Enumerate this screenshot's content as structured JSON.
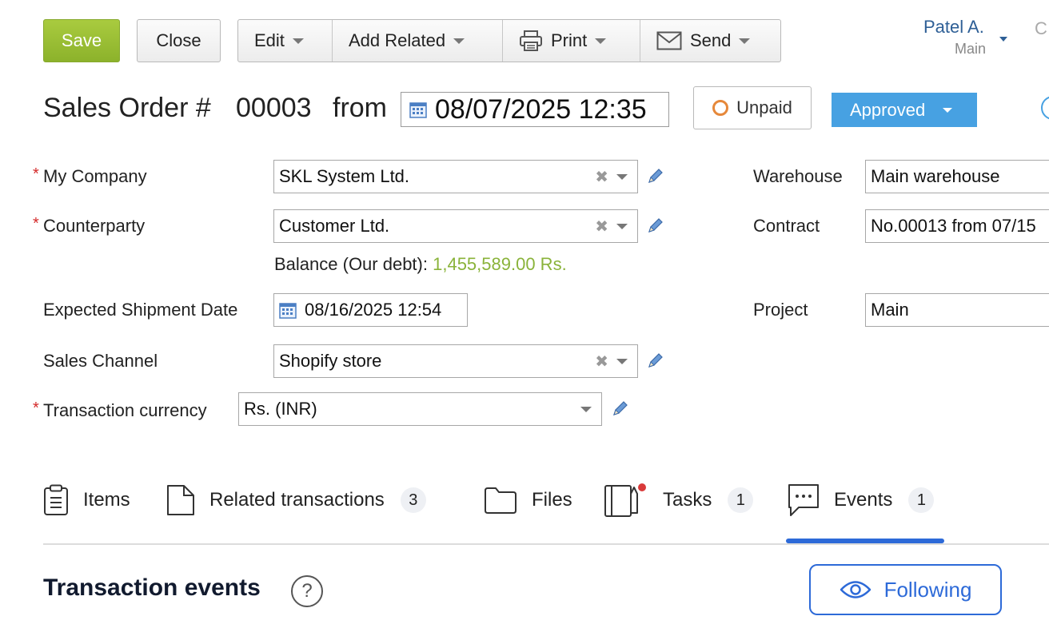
{
  "toolbar": {
    "save": "Save",
    "close": "Close",
    "edit": "Edit",
    "add_related": "Add Related",
    "print": "Print",
    "send": "Send"
  },
  "user": {
    "name": "Patel A.",
    "sub": "Main",
    "next": "C"
  },
  "header": {
    "title": "Sales Order #",
    "number": "00003",
    "from": "from",
    "date": "08/07/2025 12:35",
    "payment_status": "Unpaid",
    "approval_status": "Approved"
  },
  "form": {
    "my_company": {
      "label": "My Company",
      "value": "SKL System Ltd."
    },
    "counterparty": {
      "label": "Counterparty",
      "value": "Customer Ltd."
    },
    "balance": {
      "label": "Balance (Our debt):",
      "value": "1,455,589.00 Rs."
    },
    "shipment_date": {
      "label": "Expected Shipment Date",
      "value": "08/16/2025 12:54"
    },
    "sales_channel": {
      "label": "Sales Channel",
      "value": "Shopify store"
    },
    "currency": {
      "label": "Transaction currency",
      "value": "Rs. (INR)"
    },
    "warehouse": {
      "label": "Warehouse",
      "value": "Main warehouse"
    },
    "contract": {
      "label": "Contract",
      "value": "No.00013 from 07/15"
    },
    "project": {
      "label": "Project",
      "value": "Main"
    },
    "required_mark": "*"
  },
  "tabs": [
    {
      "label": "Items",
      "count": ""
    },
    {
      "label": "Related transactions",
      "count": "3"
    },
    {
      "label": "Files",
      "count": ""
    },
    {
      "label": "Tasks",
      "count": "1"
    },
    {
      "label": "Events",
      "count": "1"
    }
  ],
  "section": {
    "title": "Transaction events",
    "help": "?",
    "following": "Following"
  },
  "colors": {
    "save_green": "#9cc136",
    "approved_blue": "#47a1e2",
    "active_tab_blue": "#2d6ad8",
    "balance_green": "#8ab33a",
    "unpaid_orange": "#e6883a",
    "required_red": "#d42a2a"
  }
}
